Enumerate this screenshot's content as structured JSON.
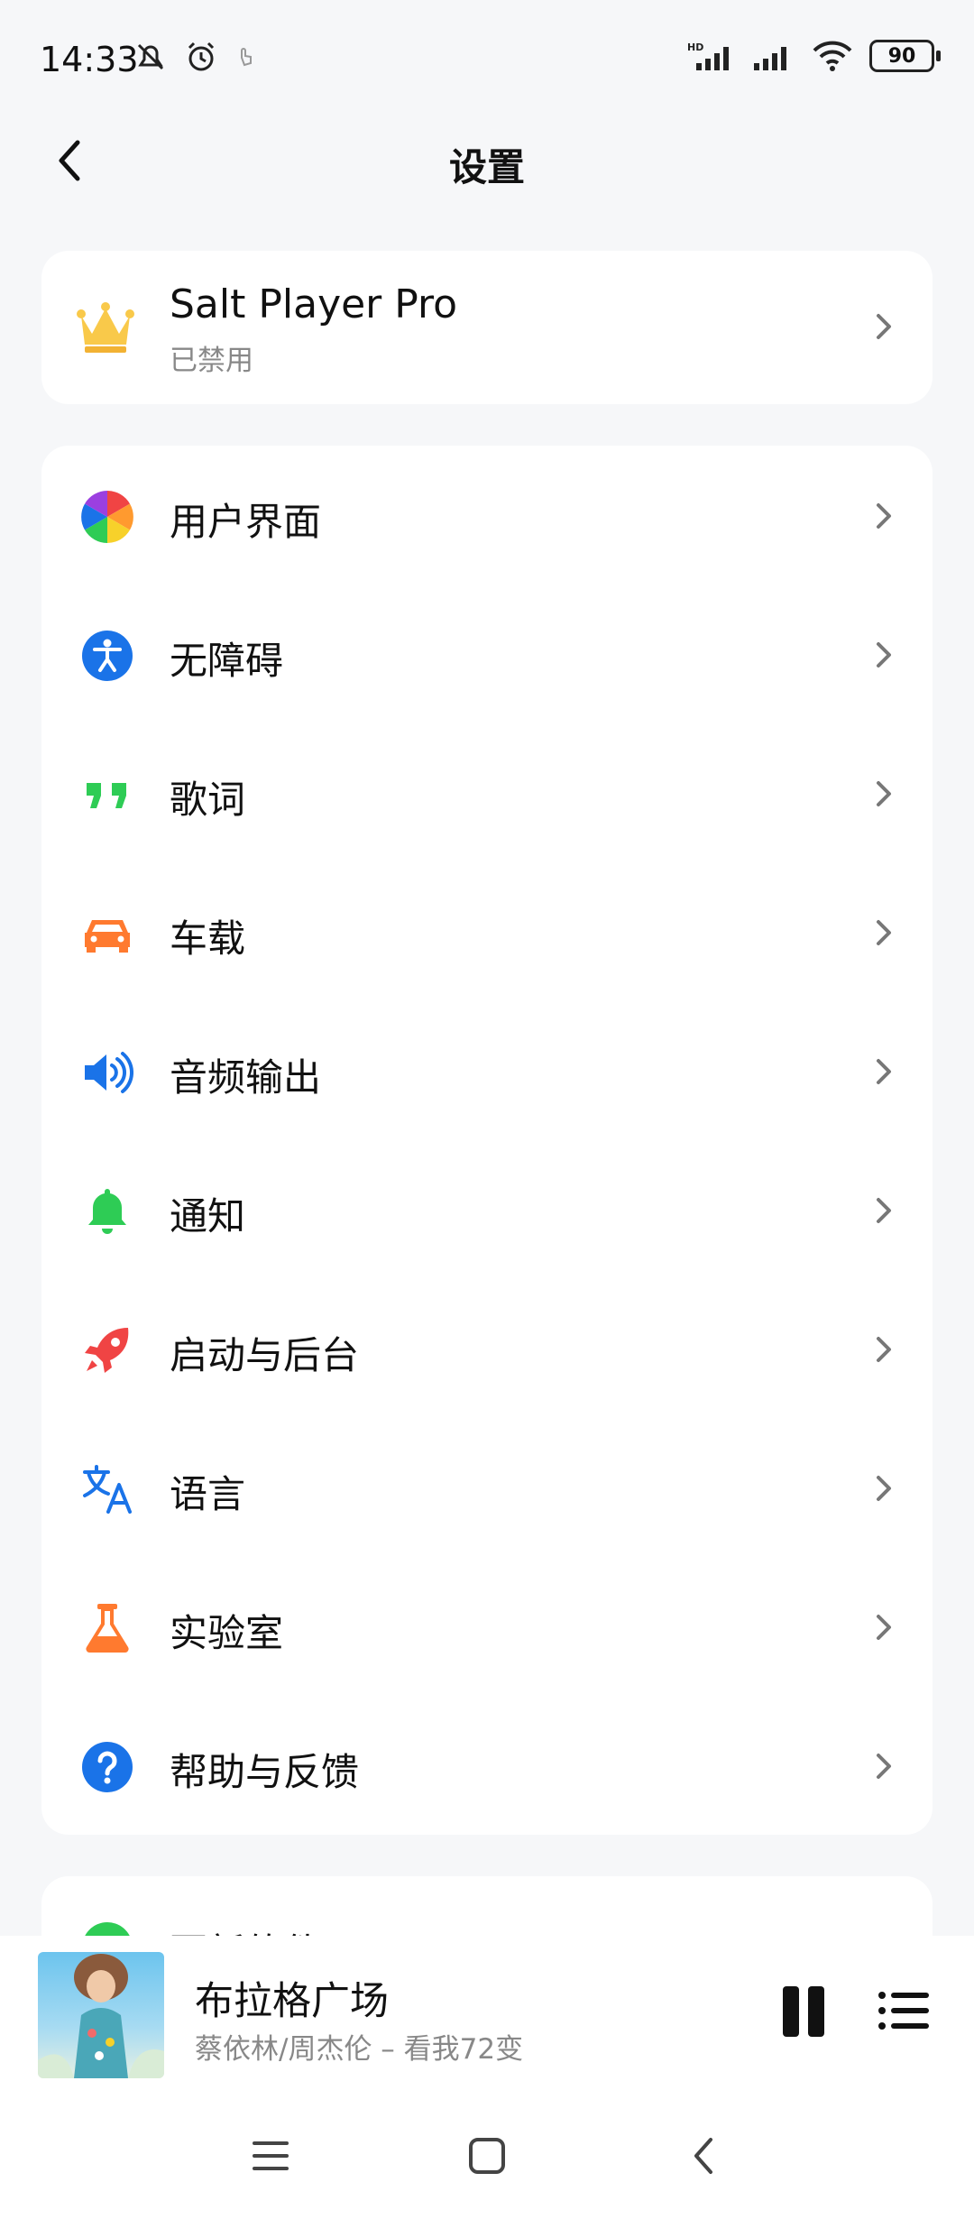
{
  "status": {
    "time": "14:33",
    "battery": "90",
    "icons": [
      "mute-icon",
      "alarm-icon",
      "touch-icon",
      "hd-signal-icon",
      "signal-icon",
      "wifi-icon",
      "battery-icon"
    ]
  },
  "header": {
    "title": "设置"
  },
  "pro": {
    "title": "Salt Player Pro",
    "subtitle": "已禁用",
    "icon": "crown-icon"
  },
  "menu": {
    "items": [
      {
        "label": "用户界面",
        "icon": "color-wheel-icon"
      },
      {
        "label": "无障碍",
        "icon": "accessibility-icon"
      },
      {
        "label": "歌词",
        "icon": "quote-icon"
      },
      {
        "label": "车载",
        "icon": "car-icon"
      },
      {
        "label": "音频输出",
        "icon": "speaker-icon"
      },
      {
        "label": "通知",
        "icon": "bell-icon"
      },
      {
        "label": "启动与后台",
        "icon": "rocket-icon"
      },
      {
        "label": "语言",
        "icon": "translate-icon"
      },
      {
        "label": "实验室",
        "icon": "flask-icon"
      },
      {
        "label": "帮助与反馈",
        "icon": "help-icon"
      }
    ]
  },
  "card3": {
    "label": "更新软件"
  },
  "now_playing": {
    "title": "布拉格广场",
    "subtitle": "蔡依林/周杰伦 – 看我72变"
  },
  "colors": {
    "background": "#f6f7f9",
    "blue": "#1a73e8",
    "green": "#2ecc55",
    "orange": "#ff7a2f",
    "red": "#f04444"
  }
}
